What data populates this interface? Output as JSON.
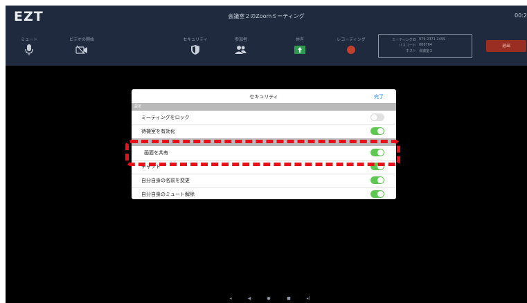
{
  "app": {
    "logo": "EZT",
    "title": "会議室２のZoomミーティング",
    "clock": "00:2"
  },
  "toolbar": {
    "mute": "ミュート",
    "video": "ビデオの開始",
    "security": "セキュリティ",
    "participants": "参加者",
    "share": "共有",
    "record": "レコーディング",
    "leave": "退出"
  },
  "meeting_info": {
    "rows": [
      {
        "k": "ミーティングID",
        "v": "979 2371 2499"
      },
      {
        "k": "パスコード",
        "v": "088764"
      },
      {
        "k": "ホスト",
        "v": "会議室２"
      }
    ]
  },
  "dialog": {
    "title": "セキュリティ",
    "done": "完了",
    "section": "設定",
    "rows": [
      {
        "label": "ミーティングをロック",
        "state": "off"
      },
      {
        "label": "待機室を有効化",
        "state": "on"
      },
      {
        "label": "画面を共有",
        "state": "on"
      },
      {
        "label": "チャット",
        "state": "on"
      },
      {
        "label": "自分自身の名前を変更",
        "state": "on"
      },
      {
        "label": "自分自身のミュート解除",
        "state": "on"
      }
    ]
  },
  "colors": {
    "toolbar_bg": "#1f2a3e",
    "toggle_on": "#5cc84f",
    "leave_button": "#9b2e22",
    "highlight": "#e8101a",
    "accent": "#2d8cff"
  },
  "icons": [
    "mic-icon",
    "video-off-icon",
    "shield-icon",
    "participants-icon",
    "share-arrow-icon",
    "record-dot-icon",
    "volume-down-icon",
    "back-icon",
    "home-icon",
    "recents-icon",
    "volume-up-icon"
  ]
}
